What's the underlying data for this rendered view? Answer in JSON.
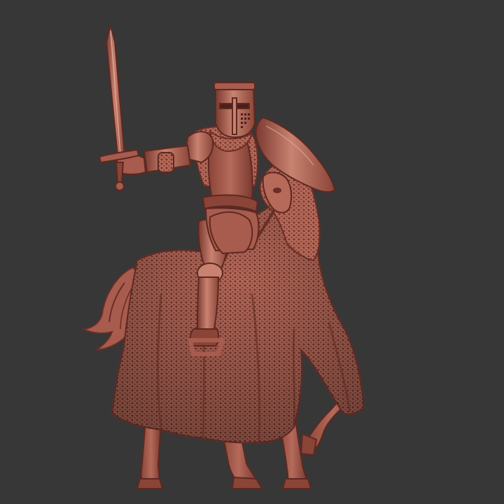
{
  "scene": {
    "subject": "mounted-knight-miniature",
    "colors": {
      "background": "#373737",
      "base": "#a85c4e",
      "light": "#c98270",
      "mid": "#93493d",
      "shadow": "#6a2e26",
      "deep": "#4a1f1a"
    }
  }
}
